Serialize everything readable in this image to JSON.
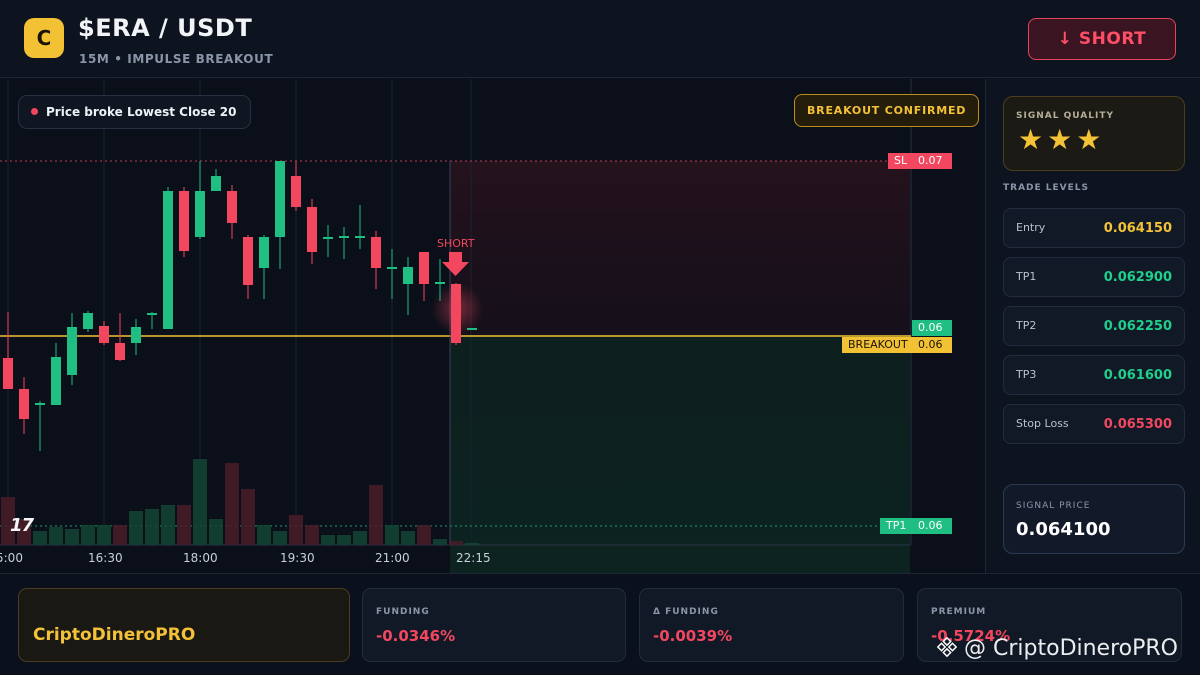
{
  "header": {
    "logo_letter": "C",
    "pair": "$ERA / USDT",
    "subtitle": "15M • IMPULSE BREAKOUT",
    "action_label": "↓ SHORT"
  },
  "chart": {
    "info_pill": "Price broke Lowest Close 20",
    "confirm_pill": "BREAKOUT CONFIRMED",
    "signal_marker": "SHORT",
    "tradingview_logo": "17",
    "price_tags": {
      "sl_key": "SL",
      "sl_value": "0.07",
      "current_value": "0.06",
      "breakout_key": "BREAKOUT",
      "breakout_value": "0.06",
      "tp1_key": "TP1",
      "tp1_value": "0.06"
    },
    "time_labels": [
      "5:00",
      "16:30",
      "18:00",
      "19:30",
      "21:00",
      "22:15"
    ],
    "colors": {
      "up": "#1fbf83",
      "down": "#f2475f",
      "breakout": "#f3c234"
    }
  },
  "sidebar": {
    "quality_label": "SIGNAL QUALITY",
    "quality_stars": "★★★",
    "levels_title": "TRADE LEVELS",
    "levels": [
      {
        "label": "Entry",
        "value": "0.064150",
        "color": "#f4c236"
      },
      {
        "label": "TP1",
        "value": "0.062900",
        "color": "#1fcf8c"
      },
      {
        "label": "TP2",
        "value": "0.062250",
        "color": "#1fcf8c"
      },
      {
        "label": "TP3",
        "value": "0.061600",
        "color": "#1fcf8c"
      },
      {
        "label": "Stop Loss",
        "value": "0.065300",
        "color": "#f2475f"
      }
    ],
    "signal_label": "SIGNAL PRICE",
    "signal_value": "0.064100"
  },
  "footer": {
    "brand": "CriptoDineroPRO",
    "metrics": [
      {
        "label": "FUNDING",
        "value": "-0.0346%"
      },
      {
        "label": "Δ FUNDING",
        "value": "-0.0039%"
      },
      {
        "label": "PREMIUM",
        "value": "-0.5724%"
      }
    ],
    "watermark": "@ CriptoDineroPRO"
  }
}
